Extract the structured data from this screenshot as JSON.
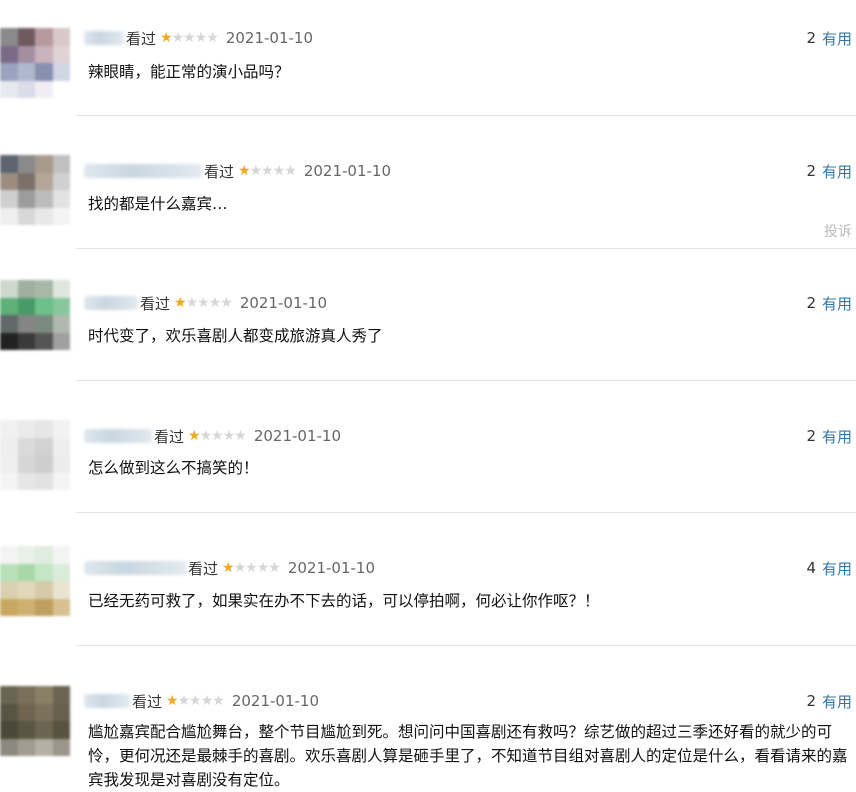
{
  "comments": [
    {
      "status": "看过",
      "rating": 1,
      "date": "2021-01-10",
      "votes": "2",
      "useful_label": "有用",
      "text": "辣眼睛，能正常的演小品吗？",
      "avatar_colors": [
        "#8a8a8a",
        "#6f5a60",
        "#b69aa0",
        "#d8c8c8",
        "#7a6a88",
        "#a38fa0",
        "#c9b3bd",
        "#e0d2d6",
        "#9aa4c0",
        "#b0b8d0",
        "#8890b0",
        "#d0d6e6",
        "#e8e8f0",
        "#dcdce8",
        "#f0eef2",
        "#ffffff"
      ]
    },
    {
      "status": "看过",
      "rating": 1,
      "date": "2021-01-10",
      "votes": "2",
      "useful_label": "有用",
      "text": "找的都是什么嘉宾…",
      "report_label": "投诉",
      "avatar_colors": [
        "#5d6470",
        "#8a8a8a",
        "#a89a8c",
        "#c0c0c0",
        "#9c8c80",
        "#7a7068",
        "#b4a698",
        "#d0d0d0",
        "#cfcfcf",
        "#9c9c9c",
        "#bcbcbc",
        "#e2e2e2",
        "#efefef",
        "#d8d8d8",
        "#e8e8e8",
        "#f4f4f4"
      ]
    },
    {
      "status": "看过",
      "rating": 1,
      "date": "2021-01-10",
      "votes": "2",
      "useful_label": "有用",
      "text": "时代变了，欢乐喜剧人都变成旅游真人秀了",
      "avatar_colors": [
        "#cfd8cf",
        "#9fb09f",
        "#a8b8a8",
        "#dfe6df",
        "#5fb07a",
        "#4a9a68",
        "#6cc08a",
        "#86c89a",
        "#606868",
        "#858585",
        "#7a8a80",
        "#b0b8b0",
        "#222222",
        "#3a3a3a",
        "#555555",
        "#a0a0a0"
      ]
    },
    {
      "status": "看过",
      "rating": 1,
      "date": "2021-01-10",
      "votes": "2",
      "useful_label": "有用",
      "text": "怎么做到这么不搞笑的！",
      "avatar_colors": [
        "#f0f0f0",
        "#ebebeb",
        "#e6e6e6",
        "#f2f2f2",
        "#eeeeee",
        "#dadada",
        "#d2d2d2",
        "#eeeeee",
        "#efefef",
        "#d6d6d6",
        "#cecece",
        "#ececec",
        "#f4f4f4",
        "#e6e6e6",
        "#e2e2e2",
        "#f4f4f4"
      ]
    },
    {
      "status": "看过",
      "rating": 1,
      "date": "2021-01-10",
      "votes": "4",
      "useful_label": "有用",
      "text": "已经无药可救了，如果实在办不下去的话，可以停拍啊，何必让你作呕？！",
      "avatar_colors": [
        "#f4f4f4",
        "#e8f0e8",
        "#dfecdf",
        "#f2f4f2",
        "#b8e0b8",
        "#a8d8a8",
        "#c4e6c4",
        "#d8ecd8",
        "#d8d0b0",
        "#e0d8b8",
        "#d4cca8",
        "#e8e4d0",
        "#c8a860",
        "#d0b070",
        "#c0a060",
        "#d8c090"
      ]
    },
    {
      "status": "看过",
      "rating": 1,
      "date": "2021-01-10",
      "votes": "2",
      "useful_label": "有用",
      "text": "尴尬嘉宾配合尴尬舞台，整个节目尴尬到死。想问问中国喜剧还有救吗？综艺做的超过三季还好看的就少的可怜，更何况还是最棘手的喜剧。欢乐喜剧人算是砸手里了，不知道节目组对喜剧人的定位是什么，看看请来的嘉宾我发现是对喜剧没有定位。",
      "avatar_colors": [
        "#6a6452",
        "#7a705a",
        "#8a8068",
        "#6a6450",
        "#5a5444",
        "#6e6450",
        "#7c725c",
        "#66604c",
        "#4a4838",
        "#5a5644",
        "#6a6450",
        "#585240",
        "#8c8a80",
        "#a09c90",
        "#b4b0a4",
        "#9a968a"
      ]
    }
  ]
}
